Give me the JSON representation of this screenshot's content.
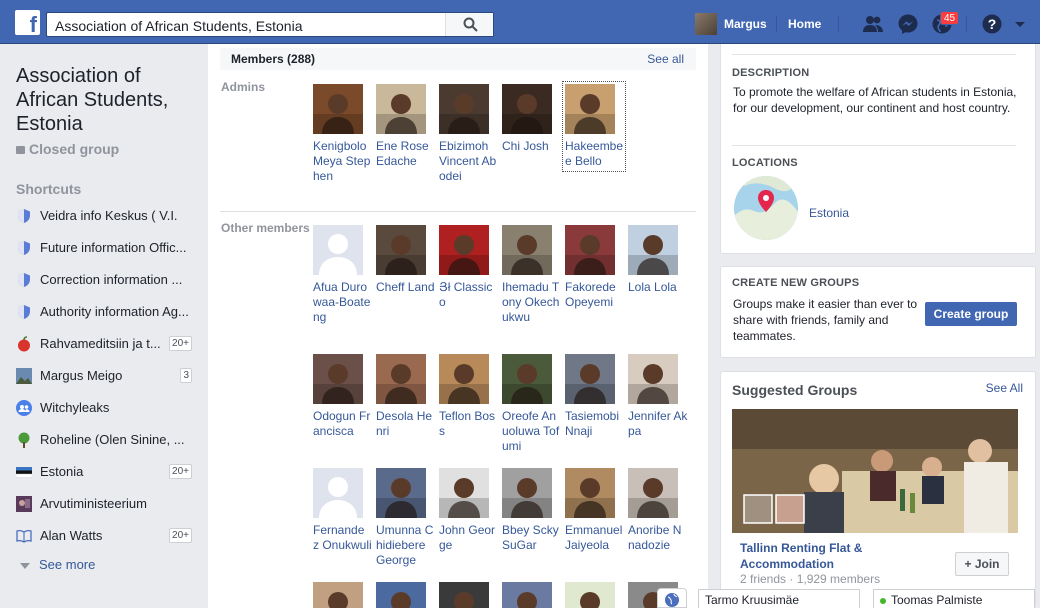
{
  "header": {
    "search_value": "Association of African Students, Estonia",
    "user_name": "Margus",
    "home_label": "Home",
    "notification_count": "45"
  },
  "group": {
    "title": "Association of African Students, Estonia",
    "privacy": "Closed group"
  },
  "shortcuts": {
    "heading": "Shortcuts",
    "items": [
      {
        "label": "Veidra info Keskus ( V.I.",
        "icon": "shield-icon",
        "count": ""
      },
      {
        "label": "Future information Offic...",
        "icon": "shield-icon",
        "count": ""
      },
      {
        "label": "Correction information ...",
        "icon": "shield-icon",
        "count": ""
      },
      {
        "label": "Authority information Ag...",
        "icon": "shield-icon",
        "count": ""
      },
      {
        "label": "Rahvameditsiin ja t...",
        "icon": "apple-icon",
        "count": "20+"
      },
      {
        "label": "Margus Meigo",
        "icon": "landscape-icon",
        "count": "3"
      },
      {
        "label": "Witchyleaks",
        "icon": "group-icon",
        "count": ""
      },
      {
        "label": "Roheline (Olen Sinine, ...",
        "icon": "tree-icon",
        "count": ""
      },
      {
        "label": "Estonia",
        "icon": "flag-icon",
        "count": "20+"
      },
      {
        "label": "Arvutiministeerium",
        "icon": "photo-icon",
        "count": ""
      },
      {
        "label": "Alan Watts",
        "icon": "book-icon",
        "count": "20+"
      }
    ],
    "see_more": "See more"
  },
  "members": {
    "heading": "Members (288)",
    "see_all": "See all",
    "admins_label": "Admins",
    "others_label": "Other members",
    "admins": [
      {
        "name": "Kenigbolo Meya Stephen",
        "color": "#7a4a2a"
      },
      {
        "name": "Ene Rose Edache",
        "color": "#c9b89a"
      },
      {
        "name": "Ebizimoh Vincent Abodei",
        "color": "#4a3a30"
      },
      {
        "name": "Chi Josh",
        "color": "#3a2a22"
      },
      {
        "name": "Hakeembee Bello",
        "color": "#c8a070"
      }
    ],
    "others": [
      {
        "name": "Afua Durowaa-Boateng",
        "color": "#d8dadf",
        "default": true
      },
      {
        "name": "Cheff Land",
        "color": "#5a4a3e"
      },
      {
        "name": "Յł Classico",
        "color": "#b02020"
      },
      {
        "name": "Ihemadu Tony Okechukwu",
        "color": "#8a8070"
      },
      {
        "name": "Fakorede Opeyemi",
        "color": "#8a3a3a"
      },
      {
        "name": "Lola Lola",
        "color": "#c0d0e0"
      },
      {
        "name": "Odogun Francisca",
        "color": "#6a5048"
      },
      {
        "name": "Desola Henri",
        "color": "#9a6a50"
      },
      {
        "name": "Teflon Boss",
        "color": "#b88a5a"
      },
      {
        "name": "Oreofe Anuoluwa Tofumi",
        "color": "#4a5a3a"
      },
      {
        "name": "Tasiemobi Nnaji",
        "color": "#707888"
      },
      {
        "name": "Jennifer Akpa",
        "color": "#d8ccc0"
      },
      {
        "name": "Fernande z Onukwuli",
        "color": "#d8dadf",
        "default": true
      },
      {
        "name": "Umunna Chidiebere George",
        "color": "#5a6a8a"
      },
      {
        "name": "John George",
        "color": "#e0e0e0"
      },
      {
        "name": "Bbey Scky SuGar",
        "color": "#a0a0a0"
      },
      {
        "name": "Emmanuel Jaiyeola",
        "color": "#b08a60"
      },
      {
        "name": "Anoribe Nnadozie",
        "color": "#c8c0b8"
      }
    ],
    "row4_colors": [
      "#c0a080",
      "#4a6aa0",
      "#3a3a3a",
      "#6a7aa0",
      "#e0e8d0",
      "#8a8a8a"
    ]
  },
  "description": {
    "heading": "DESCRIPTION",
    "text": "To promote the welfare of African students in Estonia, for our development, our continent and host country."
  },
  "locations": {
    "heading": "LOCATIONS",
    "place": "Estonia"
  },
  "create_groups": {
    "heading": "CREATE NEW GROUPS",
    "text": "Groups make it easier than ever to share with friends, family and teammates.",
    "button": "Create group"
  },
  "suggested": {
    "heading": "Suggested Groups",
    "see_all": "See All",
    "group_name": "Tallinn Renting Flat & Accommodation",
    "group_meta": "2 friends · 1,929 members",
    "join": "Join"
  },
  "chat": {
    "tab1": "Tarmo Kruusimäe",
    "tab2": "Toomas Palmiste"
  },
  "colors": {
    "brand": "#4267b2",
    "link": "#365899",
    "online": "#42b72a",
    "badge": "#fa3e3e"
  }
}
